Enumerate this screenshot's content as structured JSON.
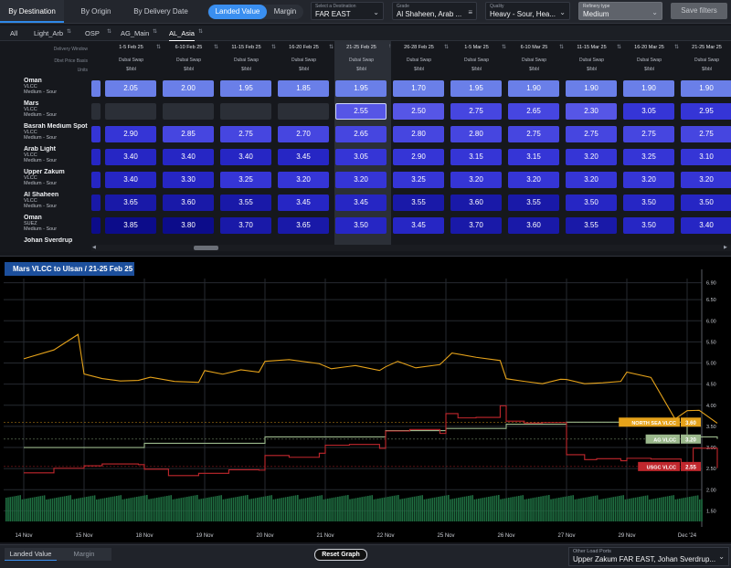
{
  "top_tabs": [
    "By Destination",
    "By Origin",
    "By Delivery Date"
  ],
  "view_toggle": [
    "Landed Value",
    "Margin"
  ],
  "selects": {
    "destination": {
      "label": "Select a Destination",
      "value": "FAR EAST"
    },
    "grade": {
      "label": "Grade",
      "value": "Al Shaheen, Arab ..."
    },
    "quality": {
      "label": "Quality",
      "value": "Heavy - Sour, Hea..."
    },
    "refinery": {
      "label": "Refinery type",
      "value": "Medium"
    }
  },
  "save_filters": "Save filters",
  "grade_tabs": [
    "All",
    "Light_Arb",
    "OSP",
    "AG_Main",
    "AL_Asia"
  ],
  "grid": {
    "row_labels": {
      "window": "Delivery Window",
      "basis": "Dbvt Price Basis",
      "units": "Units"
    },
    "columns": [
      {
        "window": "1-5 Feb 25",
        "basis": "Dubai Swap",
        "units": "$/bbl"
      },
      {
        "window": "6-10 Feb 25",
        "basis": "Dubai Swap",
        "units": "$/bbl"
      },
      {
        "window": "11-15 Feb 25",
        "basis": "Dubai Swap",
        "units": "$/bbl"
      },
      {
        "window": "16-20 Feb 25",
        "basis": "Dubai Swap",
        "units": "$/bbl"
      },
      {
        "window": "21-25 Feb 25",
        "basis": "Dubai Swap",
        "units": "$/bbl"
      },
      {
        "window": "26-28 Feb 25",
        "basis": "Dubai Swap",
        "units": "$/bbl"
      },
      {
        "window": "1-5 Mar 25",
        "basis": "Dubai Swap",
        "units": "$/bbl"
      },
      {
        "window": "6-10 Mar 25",
        "basis": "Dubai Swap",
        "units": "$/bbl"
      },
      {
        "window": "11-15 Mar 25",
        "basis": "Dubai Swap",
        "units": "$/bbl"
      },
      {
        "window": "16-20 Mar 25",
        "basis": "Dubai Swap",
        "units": "$/bbl"
      },
      {
        "window": "21-25 Mar 25",
        "basis": "Dubai Swap",
        "units": "$/bbl"
      }
    ],
    "rows": [
      {
        "name": "Oman",
        "ship": "VLCC",
        "quality": "Medium - Sour",
        "values": [
          "2.05",
          "2.00",
          "1.95",
          "1.85",
          "1.95",
          "1.70",
          "1.95",
          "1.90",
          "1.90",
          "1.90",
          "1.90"
        ]
      },
      {
        "name": "Mars",
        "ship": "VLCC",
        "quality": "Medium - Sour",
        "values": [
          "",
          "",
          "",
          "",
          "2.55",
          "2.50",
          "2.75",
          "2.65",
          "2.30",
          "3.05",
          "2.95"
        ]
      },
      {
        "name": "Basrah Medium Spot",
        "ship": "VLCC",
        "quality": "Medium - Sour",
        "values": [
          "2.90",
          "2.85",
          "2.75",
          "2.70",
          "2.65",
          "2.80",
          "2.80",
          "2.75",
          "2.75",
          "2.75",
          "2.75"
        ]
      },
      {
        "name": "Arab Light",
        "ship": "VLCC",
        "quality": "Medium - Sour",
        "values": [
          "3.40",
          "3.40",
          "3.40",
          "3.45",
          "3.05",
          "2.90",
          "3.15",
          "3.15",
          "3.20",
          "3.25",
          "3.10"
        ]
      },
      {
        "name": "Upper Zakum",
        "ship": "VLCC",
        "quality": "Medium - Sour",
        "values": [
          "3.40",
          "3.30",
          "3.25",
          "3.20",
          "3.20",
          "3.25",
          "3.20",
          "3.20",
          "3.20",
          "3.20",
          "3.20"
        ]
      },
      {
        "name": "Al Shaheen",
        "ship": "VLCC",
        "quality": "Medium - Sour",
        "values": [
          "3.65",
          "3.60",
          "3.55",
          "3.45",
          "3.45",
          "3.55",
          "3.60",
          "3.55",
          "3.50",
          "3.50",
          "3.50"
        ]
      },
      {
        "name": "Oman",
        "ship": "SUEZ",
        "quality": "Medium - Sour",
        "values": [
          "3.85",
          "3.80",
          "3.70",
          "3.65",
          "3.50",
          "3.45",
          "3.70",
          "3.60",
          "3.55",
          "3.50",
          "3.40"
        ]
      },
      {
        "name": "Johan Sverdrup",
        "ship": "",
        "quality": "",
        "values": []
      }
    ]
  },
  "chart": {
    "title": "Mars VLCC to Ulsan / 21-25 Feb 25",
    "markers": [
      {
        "label": "NORTH SEA VLCC",
        "value": "3.60",
        "color": "#e5a21a"
      },
      {
        "label": "AG VLCC",
        "value": "3.20",
        "color": "#9bb88c"
      },
      {
        "label": "USGC VLCC",
        "value": "2.55",
        "color": "#c1272d"
      }
    ]
  },
  "chart_data": {
    "type": "line",
    "x_ticks": [
      "14 Nov",
      "15 Nov",
      "18 Nov",
      "19 Nov",
      "20 Nov",
      "21 Nov",
      "22 Nov",
      "25 Nov",
      "26 Nov",
      "27 Nov",
      "29 Nov",
      "Dec '24"
    ],
    "y_ticks": [
      1.5,
      2.0,
      2.5,
      3.0,
      3.5,
      4.0,
      4.5,
      5.0,
      5.5,
      6.0,
      6.5,
      6.9
    ],
    "ylim": [
      1.25,
      7.0
    ],
    "series": [
      {
        "name": "NORTH SEA VLCC",
        "color": "#e5a21a",
        "x": [
          0,
          0.5,
          0.9,
          1.0,
          1.3,
          1.6,
          1.9,
          2.1,
          2.5,
          2.9,
          3.0,
          3.3,
          3.6,
          3.9,
          4.0,
          4.4,
          4.9,
          5.1,
          5.5,
          5.9,
          6.0,
          6.2,
          6.5,
          6.9,
          7.1,
          7.5,
          7.9,
          8.0,
          8.3,
          8.6,
          8.9,
          9.0,
          9.3,
          9.6,
          9.9,
          10.0,
          10.4,
          10.8,
          11.0,
          11.2,
          11.5
        ],
        "y": [
          5.1,
          5.3,
          5.7,
          4.7,
          4.65,
          4.6,
          4.55,
          4.7,
          4.6,
          4.55,
          4.85,
          4.75,
          4.8,
          4.8,
          5.0,
          5.05,
          4.95,
          4.9,
          4.95,
          4.8,
          4.95,
          5.0,
          4.9,
          5.0,
          5.2,
          5.1,
          5.05,
          4.6,
          4.55,
          4.55,
          4.6,
          4.65,
          4.5,
          4.5,
          4.6,
          4.75,
          4.65,
          3.7,
          3.85,
          3.9,
          3.6
        ]
      },
      {
        "name": "AG VLCC",
        "color": "#9bb88c",
        "x": [
          0,
          1,
          2,
          3,
          4,
          5,
          6,
          7,
          8,
          9,
          10,
          11,
          11.5
        ],
        "y": [
          3.0,
          3.0,
          3.1,
          3.1,
          3.25,
          3.25,
          3.4,
          3.45,
          3.55,
          3.6,
          3.6,
          3.25,
          3.2
        ]
      },
      {
        "name": "USGC VLCC",
        "color": "#c1272d",
        "x": [
          0,
          0.5,
          1,
          1.3,
          1.9,
          2.0,
          2.4,
          2.9,
          3.0,
          3.4,
          3.9,
          4.0,
          4.4,
          4.9,
          5.0,
          5.4,
          5.9,
          6.0,
          6.4,
          6.9,
          7.0,
          7.2,
          7.5,
          7.9,
          8.0,
          8.3,
          8.6,
          9.0,
          9.3,
          9.5,
          9.9,
          10.0,
          10.4,
          10.9,
          11.1,
          11.5
        ],
        "y": [
          2.4,
          2.5,
          2.55,
          2.65,
          2.6,
          2.45,
          2.3,
          2.35,
          2.4,
          2.45,
          2.45,
          2.85,
          2.8,
          2.9,
          3.05,
          3.1,
          3.0,
          3.35,
          3.4,
          3.3,
          3.8,
          3.7,
          3.75,
          4.0,
          3.65,
          3.6,
          3.55,
          2.8,
          2.75,
          2.7,
          2.65,
          2.75,
          2.7,
          2.6,
          3.0,
          2.55
        ]
      }
    ]
  },
  "bottom_tabs": [
    "Landed Value",
    "Margin"
  ],
  "reset_graph": "Reset Graph",
  "other_load_ports": {
    "label": "Other Load Ports",
    "value": "Upper Zakum FAR EAST, Johan Sverdrup..."
  }
}
